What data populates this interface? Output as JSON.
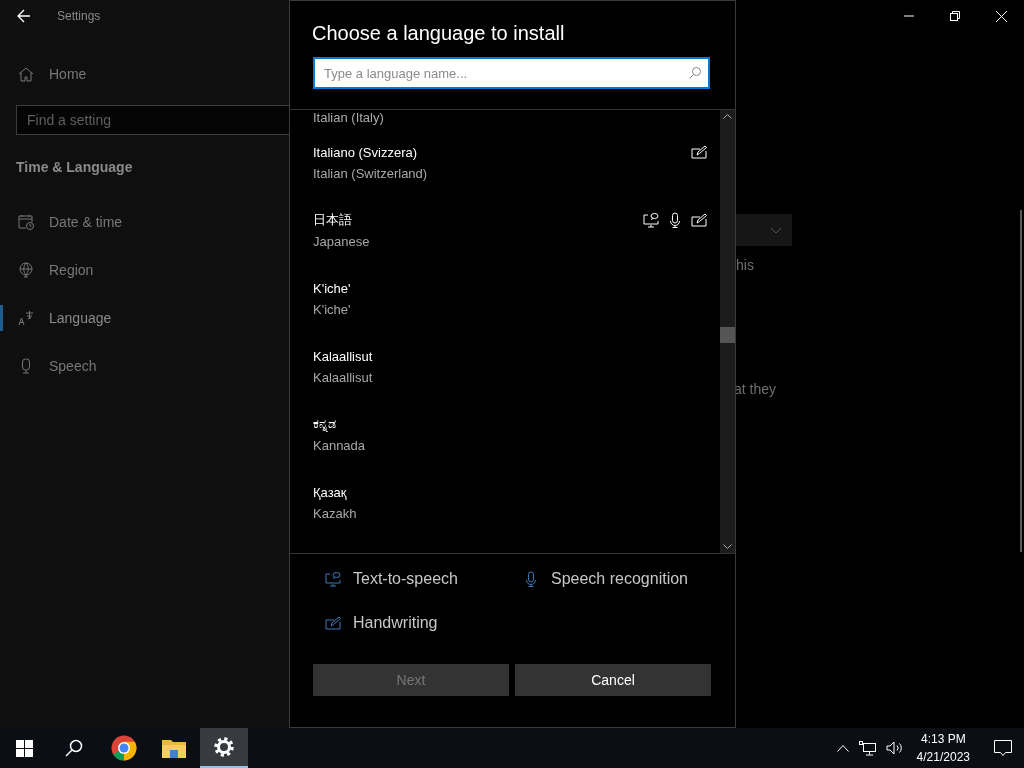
{
  "settings_window": {
    "title": "Settings",
    "home": "Home",
    "search": {
      "placeholder": "Find a setting"
    },
    "section": "Time & Language",
    "nav": [
      {
        "label": "Date & time",
        "selected": false
      },
      {
        "label": "Region",
        "selected": false
      },
      {
        "label": "Language",
        "selected": true
      },
      {
        "label": "Speech",
        "selected": false
      }
    ],
    "content_fragments": [
      "his",
      "at they"
    ]
  },
  "dialog": {
    "title": "Choose a language to install",
    "search": {
      "placeholder": "Type a language name..."
    },
    "clipped_item": "Italian (Italy)",
    "languages": [
      {
        "native": "Italiano (Svizzera)",
        "english": "Italian (Switzerland)",
        "text_to_speech": false,
        "speech": false,
        "handwriting": true
      },
      {
        "native": "日本語",
        "english": "Japanese",
        "text_to_speech": true,
        "speech": true,
        "handwriting": true
      },
      {
        "native": "K'iche'",
        "english": "K'iche'",
        "text_to_speech": false,
        "speech": false,
        "handwriting": false
      },
      {
        "native": "Kalaallisut",
        "english": "Kalaallisut",
        "text_to_speech": false,
        "speech": false,
        "handwriting": false
      },
      {
        "native": "ಕನ್ನಡ",
        "english": "Kannada",
        "text_to_speech": false,
        "speech": false,
        "handwriting": false
      },
      {
        "native": "Қазақ",
        "english": "Kazakh",
        "text_to_speech": false,
        "speech": false,
        "handwriting": false
      }
    ],
    "legend": [
      {
        "kind": "text_to_speech",
        "label": "Text-to-speech"
      },
      {
        "kind": "speech",
        "label": "Speech recognition"
      },
      {
        "kind": "handwriting",
        "label": "Handwriting"
      }
    ],
    "buttons": [
      {
        "label": "Next",
        "disabled": true
      },
      {
        "label": "Cancel",
        "disabled": false
      }
    ]
  },
  "taskbar": {
    "apps": [
      {
        "kind": "start",
        "selected": false
      },
      {
        "kind": "search",
        "selected": false
      },
      {
        "kind": "chrome",
        "selected": false
      },
      {
        "kind": "explorer",
        "selected": false
      },
      {
        "kind": "settings",
        "selected": true
      }
    ],
    "time": "4:13 PM",
    "date": "4/21/2023"
  }
}
